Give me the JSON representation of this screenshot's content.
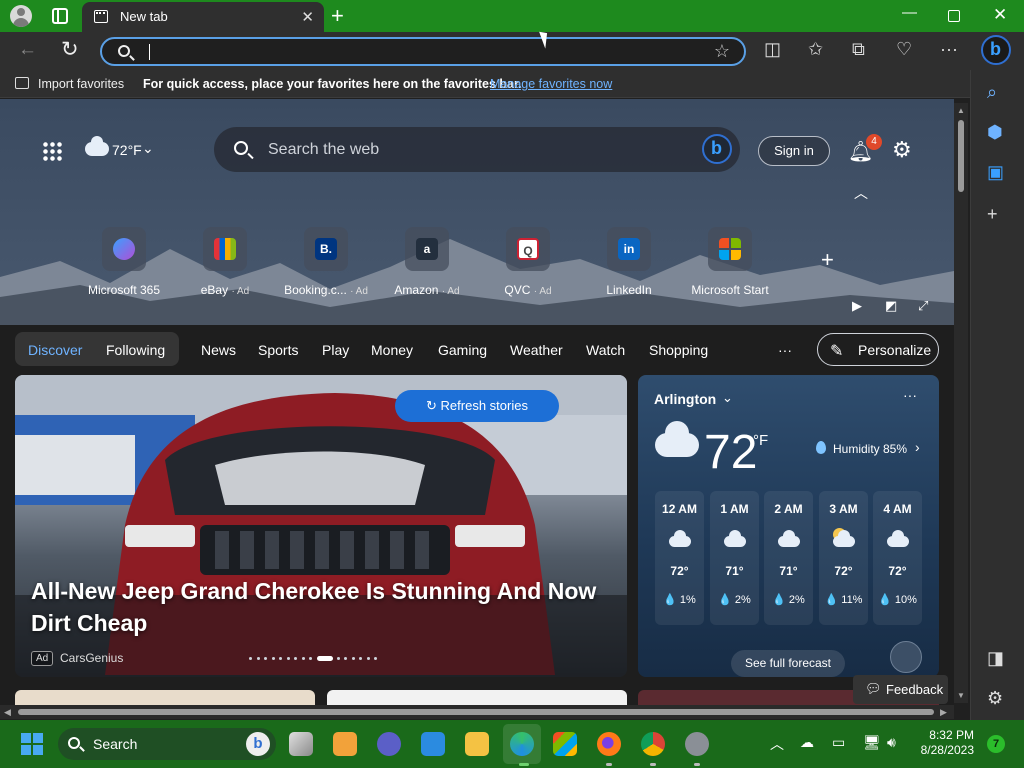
{
  "browser": {
    "tab_title": "New tab",
    "tab_close": "✕",
    "new_tab": "+",
    "address_value": "",
    "favorites_bar": {
      "import_label": "Import favorites",
      "message": "For quick access, place your favorites here on the favorites bar.",
      "manage_link": "Manage favorites now"
    }
  },
  "page": {
    "weather_mini": "72°F",
    "search_placeholder": "Search the web",
    "sign_in": "Sign in",
    "notification_count": "4",
    "quick_links": [
      {
        "label": "Microsoft 365",
        "ad": ""
      },
      {
        "label": "eBay",
        "ad": "· Ad"
      },
      {
        "label": "Booking.c...",
        "ad": "· Ad"
      },
      {
        "label": "Amazon",
        "ad": "· Ad"
      },
      {
        "label": "QVC",
        "ad": "· Ad"
      },
      {
        "label": "LinkedIn",
        "ad": ""
      },
      {
        "label": "Microsoft Start",
        "ad": ""
      }
    ],
    "feed_tabs": {
      "discover": "Discover",
      "following": "Following",
      "news": "News",
      "sports": "Sports",
      "play": "Play",
      "money": "Money",
      "gaming": "Gaming",
      "weather": "Weather",
      "watch": "Watch",
      "shopping": "Shopping",
      "more": "···",
      "personalize": "Personalize"
    },
    "hero": {
      "refresh": "Refresh stories",
      "title": "All-New Jeep Grand Cherokee Is Stunning And Now Dirt Cheap",
      "ad_badge": "Ad",
      "source": "CarsGenius",
      "slide_count": 16,
      "active_slide": 9
    },
    "weather": {
      "city": "Arlington",
      "more": "···",
      "temp": "72",
      "unit": "°F",
      "humidity": "Humidity 85%",
      "hours": [
        {
          "time": "12 AM",
          "icon": "cloud-icon",
          "temp": "72°",
          "precip": "💧 1%"
        },
        {
          "time": "1 AM",
          "icon": "cloud-icon",
          "temp": "71°",
          "precip": "💧 2%"
        },
        {
          "time": "2 AM",
          "icon": "cloud-icon",
          "temp": "71°",
          "precip": "💧 2%"
        },
        {
          "time": "3 AM",
          "icon": "moon-cloud-icon",
          "temp": "72°",
          "precip": "💧 11%"
        },
        {
          "time": "4 AM",
          "icon": "cloud-icon",
          "temp": "72°",
          "precip": "💧 10%"
        }
      ],
      "forecast_button": "See full forecast"
    },
    "feedback": "Feedback"
  },
  "taskbar": {
    "search_label": "Search",
    "time": "8:32 PM",
    "date": "8/28/2023",
    "notification_count": "7"
  },
  "colors": {
    "accent": "#1d6fd6",
    "link": "#6fb3ff",
    "titlebar": "#1e8a1e",
    "taskbar": "#1a6a1a"
  }
}
